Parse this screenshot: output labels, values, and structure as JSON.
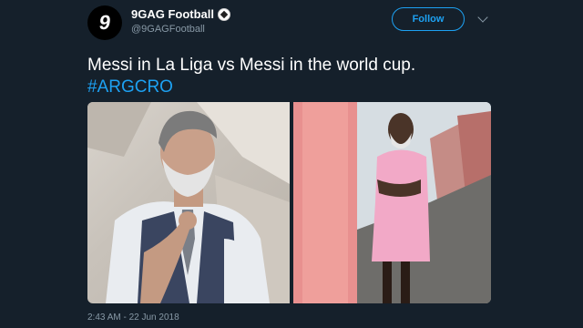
{
  "tweet": {
    "display_name": "9GAG Football",
    "handle": "@9GAGFootball",
    "follow_label": "Follow",
    "text": "Messi in La Liga vs Messi in the world cup.",
    "hashtag": "#ARGCRO",
    "timestamp": "2:43 AM - 22 Jun 2018",
    "avatar_glyph": "9"
  },
  "icons": {
    "verified": "football-icon",
    "menu": "chevron-down-icon"
  },
  "colors": {
    "background": "#15202b",
    "accent": "#1da1f2",
    "muted": "#8899a6"
  }
}
